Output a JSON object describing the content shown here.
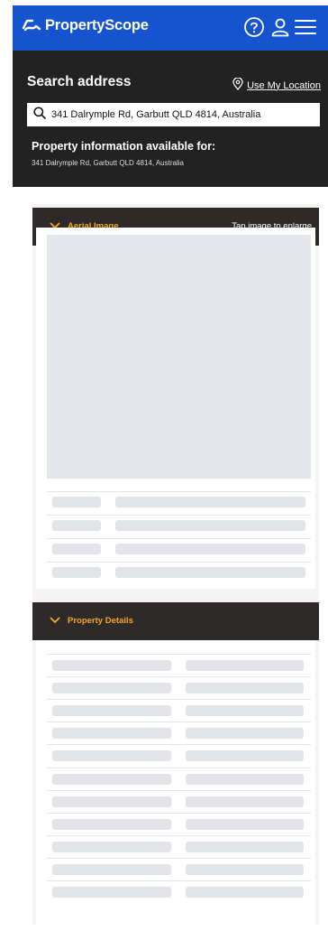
{
  "header": {
    "brand": "PropertyScope",
    "icons": [
      "help-icon",
      "account-icon",
      "menu-icon"
    ],
    "brand_color": "#1553cf"
  },
  "search": {
    "title": "Search address",
    "use_location_label": "Use My Location",
    "input_value": "341 Dalrymple Rd, Garbutt QLD 4814, Australia",
    "info_title": "Property information available for:",
    "info_address": "341 Dalrymple Rd, Garbutt QLD 4814, Australia"
  },
  "aerial": {
    "label": "Aerial Image",
    "hint": "Tap image to enlarge",
    "skeleton_rows": 4
  },
  "details": {
    "label": "Property Details",
    "skeleton_rows": 11
  },
  "colors": {
    "accent": "#f5a623",
    "panel_dark": "#222222",
    "section_dark": "#2d2a29"
  }
}
